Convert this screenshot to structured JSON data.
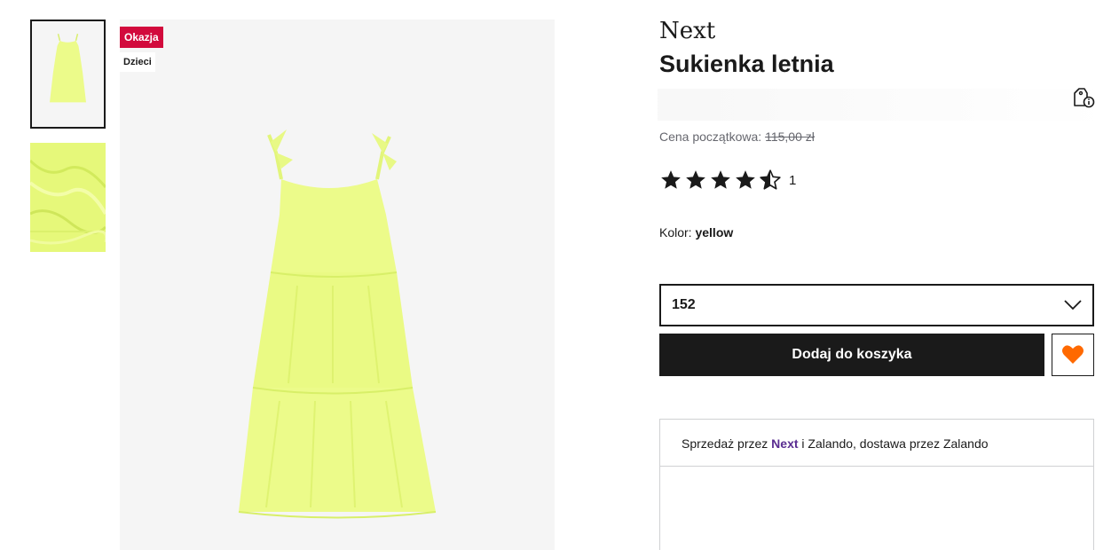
{
  "badges": {
    "sale": "Okazja",
    "category": "Dzieci"
  },
  "product": {
    "brand": "Next",
    "title": "Sukienka letnia",
    "original_price_label": "Cena początkowa:",
    "original_price": "115,00 zł",
    "rating": 4.5,
    "rating_count": "1",
    "color_label": "Kolor:",
    "color_value": "yellow"
  },
  "size_select": {
    "selected": "152"
  },
  "actions": {
    "add_to_cart": "Dodaj do koszyka"
  },
  "seller": {
    "prefix": "Sprzedaż przez",
    "brand": "Next",
    "suffix": "i Zalando, dostawa przez Zalando"
  },
  "colors": {
    "dress": "#ecfb8a",
    "sale_badge": "#d20a3c",
    "button": "#1a1a1a",
    "heart": "#ff6900",
    "brand_link": "#5a2d91"
  }
}
